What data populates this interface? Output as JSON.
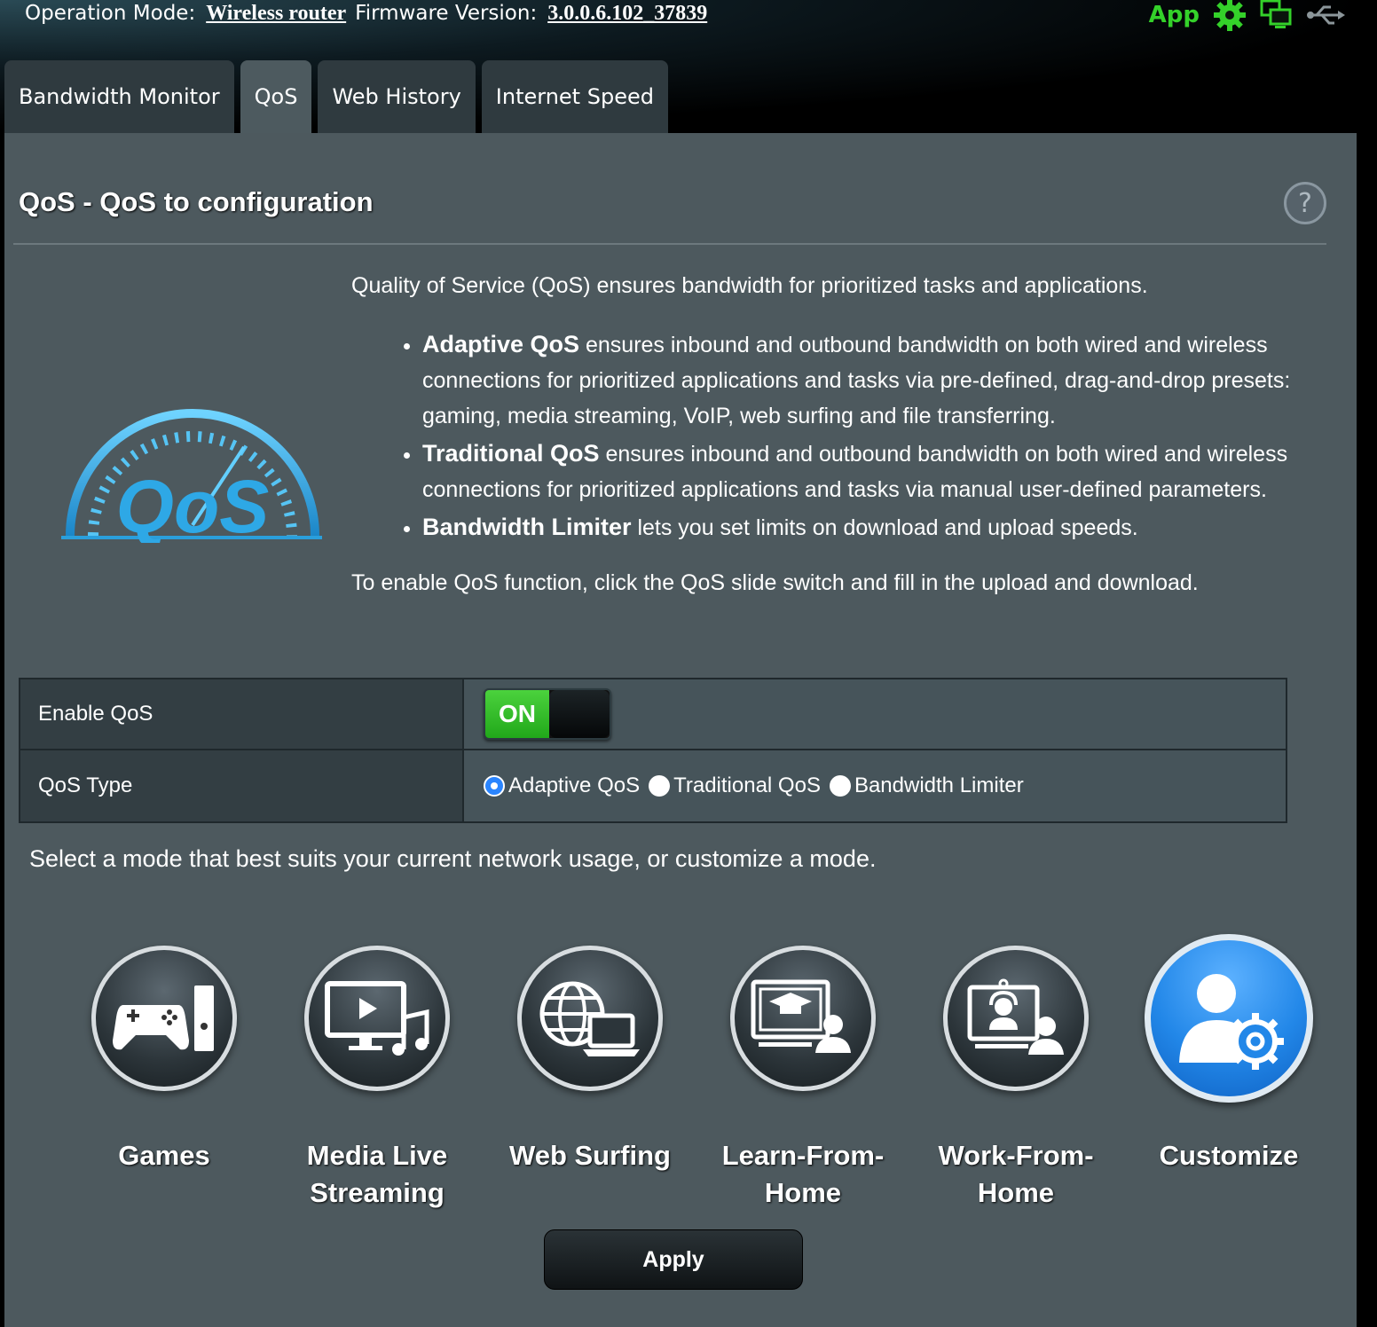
{
  "status": {
    "op_mode_label": "Operation Mode:",
    "op_mode_value": "Wireless router",
    "firmware_label": "Firmware Version:",
    "firmware_value": "3.0.0.6.102_37839",
    "app_label": "App"
  },
  "icons": [
    "gear-icon",
    "network-icon",
    "usb-icon"
  ],
  "tabs": [
    {
      "label": "Bandwidth Monitor",
      "active": false
    },
    {
      "label": "QoS",
      "active": true
    },
    {
      "label": "Web History",
      "active": false
    },
    {
      "label": "Internet Speed",
      "active": false
    }
  ],
  "panel": {
    "title": "QoS - QoS to configuration",
    "help": "?",
    "intro": "Quality of Service (QoS) ensures bandwidth for prioritized tasks and applications.",
    "bullets": [
      {
        "term": "Adaptive QoS",
        "text": " ensures inbound and outbound bandwidth on both wired and wireless connections for prioritized applications and tasks via pre-defined, drag-and-drop presets: gaming, media streaming, VoIP, web surfing and file transferring."
      },
      {
        "term": "Traditional QoS",
        "text": " ensures inbound and outbound bandwidth on both wired and wireless connections for prioritized applications and tasks via manual user-defined parameters."
      },
      {
        "term": "Bandwidth Limiter",
        "text": " lets you set limits on download and upload speeds."
      }
    ],
    "enable_note": "To enable QoS function, click the QoS slide switch and fill in the upload and download."
  },
  "form": {
    "enable_label": "Enable QoS",
    "switch_on": "ON",
    "type_label": "QoS Type",
    "types": [
      {
        "label": "Adaptive QoS",
        "selected": true
      },
      {
        "label": "Traditional QoS",
        "selected": false
      },
      {
        "label": "Bandwidth Limiter",
        "selected": false
      }
    ]
  },
  "select_text": "Select a mode that best suits your current network usage, or customize a mode.",
  "modes": [
    {
      "label": "Games",
      "icon": "gamepad-icon",
      "selected": false
    },
    {
      "label": "Media Live Streaming",
      "icon": "media-streaming-icon",
      "selected": false
    },
    {
      "label": "Web Surfing",
      "icon": "web-surfing-icon",
      "selected": false
    },
    {
      "label": "Learn-From-Home",
      "icon": "learn-from-home-icon",
      "selected": false
    },
    {
      "label": "Work-From-Home",
      "icon": "work-from-home-icon",
      "selected": false
    },
    {
      "label": "Customize",
      "icon": "customize-icon",
      "selected": true
    }
  ],
  "apply_label": "Apply",
  "colors": {
    "accent_green": "#34d12a",
    "selected_blue": "#2287e8",
    "panel": "#4d595e"
  }
}
